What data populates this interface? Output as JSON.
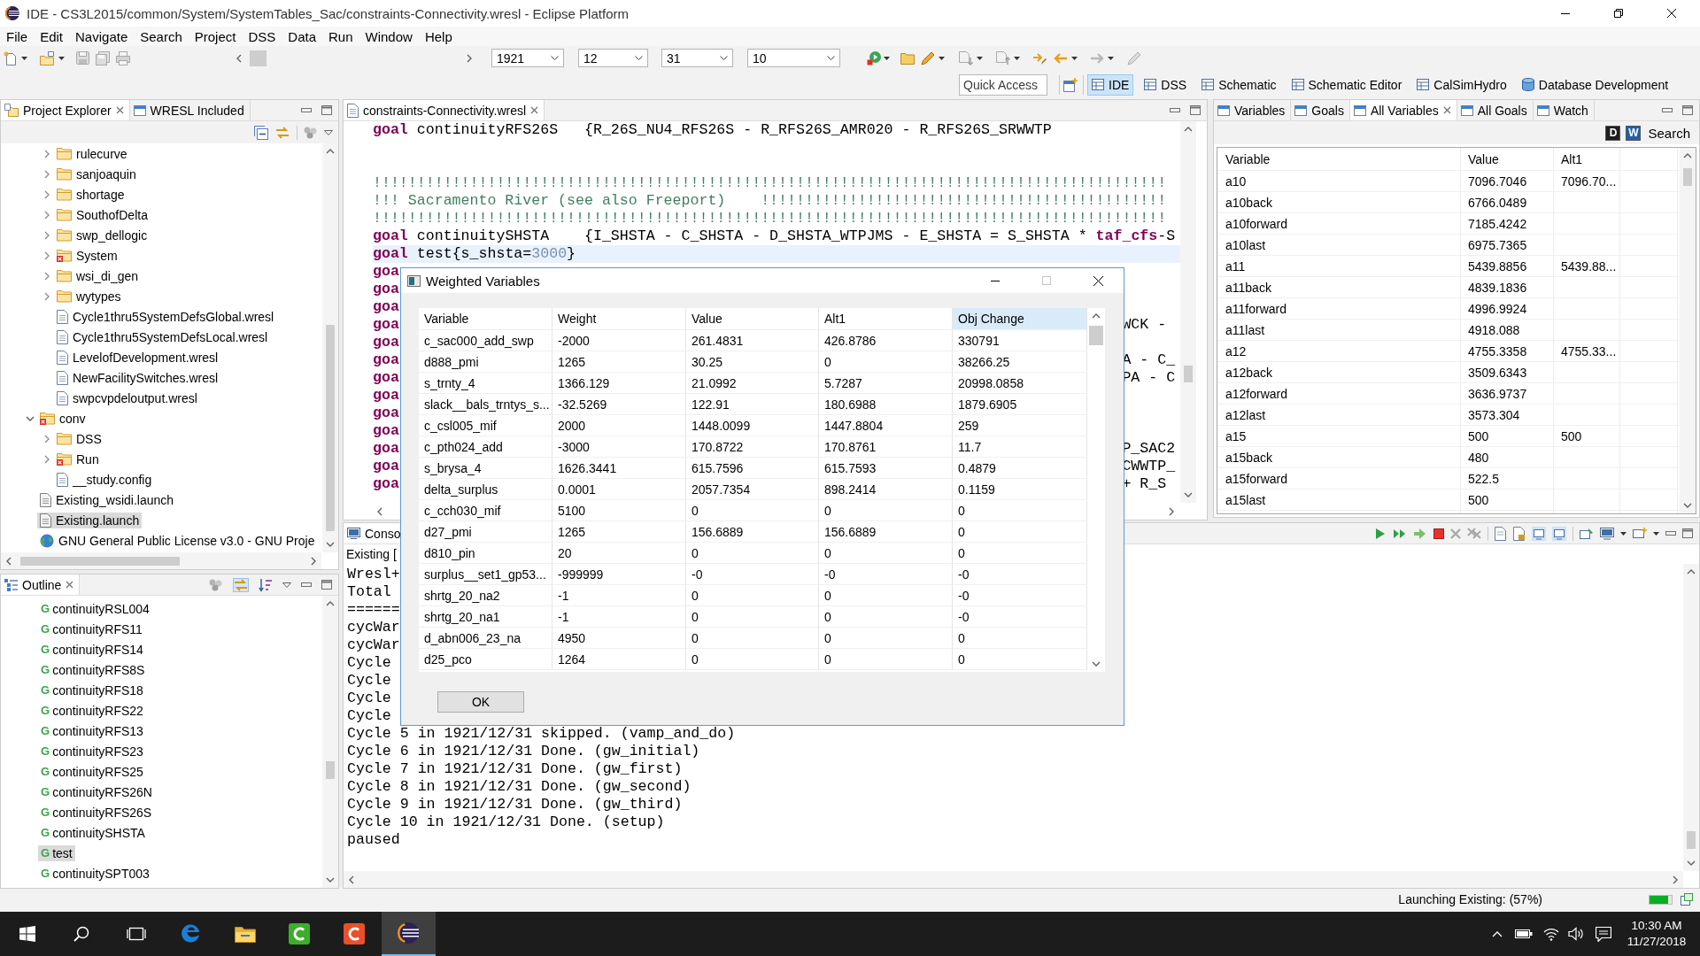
{
  "window": {
    "title": "IDE - CS3L2015/common/System/SystemTables_Sac/constraints-Connectivity.wresl - Eclipse Platform"
  },
  "menu": [
    "File",
    "Edit",
    "Navigate",
    "Search",
    "Project",
    "DSS",
    "Data",
    "Run",
    "Window",
    "Help"
  ],
  "toolbar": {
    "dropdowns": [
      {
        "value": "1921"
      },
      {
        "value": "12"
      },
      {
        "value": "31"
      },
      {
        "value": "10"
      }
    ],
    "quick_access": {
      "placeholder": "Quick Access"
    },
    "perspectives": [
      {
        "kind": "view",
        "label": "IDE",
        "selected": true
      },
      {
        "kind": "view",
        "label": "DSS",
        "selected": false
      },
      {
        "kind": "view",
        "label": "Schematic",
        "selected": false
      },
      {
        "kind": "view",
        "label": "Schematic Editor",
        "selected": false
      },
      {
        "kind": "view",
        "label": "CalSimHydro",
        "selected": false
      },
      {
        "kind": "database",
        "label": "Database Development",
        "selected": false
      }
    ]
  },
  "project_explorer": {
    "tabs": [
      {
        "label": "Project Explorer",
        "selected": true
      },
      {
        "label": "WRESL Included",
        "selected": false
      }
    ],
    "scrolled_children": [
      {
        "kind": "folder",
        "label": "rulecurve",
        "expanded": false,
        "error": false,
        "selected": false
      },
      {
        "kind": "folder",
        "label": "sanjoaquin",
        "expanded": false,
        "error": false,
        "selected": false
      },
      {
        "kind": "folder",
        "label": "shortage",
        "expanded": false,
        "error": false,
        "selected": false
      },
      {
        "kind": "folder",
        "label": "SouthofDelta",
        "expanded": false,
        "error": false,
        "selected": false
      },
      {
        "kind": "folder",
        "label": "swp_dellogic",
        "expanded": false,
        "error": false,
        "selected": false
      },
      {
        "kind": "folder",
        "label": "System",
        "expanded": false,
        "error": true,
        "selected": false
      },
      {
        "kind": "folder",
        "label": "wsi_di_gen",
        "expanded": false,
        "error": false,
        "selected": false
      },
      {
        "kind": "folder",
        "label": "wytypes",
        "expanded": false,
        "error": false,
        "selected": false
      },
      {
        "kind": "file",
        "label": "Cycle1thru5SystemDefsGlobal.wresl",
        "error": false,
        "selected": false
      },
      {
        "kind": "file",
        "label": "Cycle1thru5SystemDefsLocal.wresl",
        "error": false,
        "selected": false
      },
      {
        "kind": "file",
        "label": "LevelofDevelopment.wresl",
        "error": false,
        "selected": false
      },
      {
        "kind": "file",
        "label": "NewFacilitySwitches.wresl",
        "error": false,
        "selected": false
      },
      {
        "kind": "file",
        "label": "swpcvpdeloutput.wresl",
        "error": false,
        "selected": false
      }
    ],
    "items": [
      {
        "kind": "folder",
        "label": "conv",
        "expanded": true,
        "error": true,
        "selected": false,
        "children": [
          {
            "kind": "folder",
            "label": "DSS",
            "expanded": false,
            "error": false,
            "selected": false
          },
          {
            "kind": "folder",
            "label": "Run",
            "expanded": false,
            "error": true,
            "selected": false
          },
          {
            "kind": "file",
            "label": "__study.config",
            "error": false,
            "selected": false
          }
        ]
      },
      {
        "kind": "launch",
        "label": "Existing_wsidi.launch",
        "error": false,
        "selected": false
      },
      {
        "kind": "launch",
        "label": "Existing.launch",
        "error": false,
        "selected": true
      },
      {
        "kind": "web",
        "label": "GNU General Public License v3.0 - GNU Proje",
        "error": false,
        "selected": false
      }
    ]
  },
  "outline": {
    "title": "Outline",
    "items": [
      {
        "letter": "G",
        "label": "continuityRSL004",
        "selected": false
      },
      {
        "letter": "G",
        "label": "continuityRFS11",
        "selected": false
      },
      {
        "letter": "G",
        "label": "continuityRFS14",
        "selected": false
      },
      {
        "letter": "G",
        "label": "continuityRFS8S",
        "selected": false
      },
      {
        "letter": "G",
        "label": "continuityRFS18",
        "selected": false
      },
      {
        "letter": "G",
        "label": "continuityRFS22",
        "selected": false
      },
      {
        "letter": "G",
        "label": "continuityRFS13",
        "selected": false
      },
      {
        "letter": "G",
        "label": "continuityRFS23",
        "selected": false
      },
      {
        "letter": "G",
        "label": "continuityRFS25",
        "selected": false
      },
      {
        "letter": "G",
        "label": "continuityRFS26N",
        "selected": false
      },
      {
        "letter": "G",
        "label": "continuityRFS26S",
        "selected": false
      },
      {
        "letter": "G",
        "label": "continuitySHSTA",
        "selected": false
      },
      {
        "letter": "G",
        "label": "test",
        "selected": true
      },
      {
        "letter": "G",
        "label": "continuitySPT003",
        "selected": false
      }
    ]
  },
  "editor": {
    "tab": "constraints-Connectivity.wresl",
    "lines": [
      {
        "kind": "code",
        "current": false,
        "segments": [
          {
            "kind": "keyword",
            "text": "goal"
          },
          {
            "kind": "plain",
            "text": " continuityRFS26S   {R_26S_NU4_RFS26S - R_RFS26S_AMR020 - R_RFS26S_SRWWTP"
          }
        ]
      },
      {
        "kind": "blank"
      },
      {
        "kind": "blank"
      },
      {
        "kind": "code",
        "current": false,
        "segments": [
          {
            "kind": "comment",
            "text": "!!!!!!!!!!!!!!!!!!!!!!!!!!!!!!!!!!!!!!!!!!!!!!!!!!!!!!!!!!!!!!!!!!!!!!!!!!!!!!!!!!!!!!!!!!"
          }
        ]
      },
      {
        "kind": "code",
        "current": false,
        "segments": [
          {
            "kind": "comment",
            "text": "!!! Sacramento River (see also Freeport)    !!!!!!!!!!!!!!!!!!!!!!!!!!!!!!!!!!!!!!!!!!!!!!"
          }
        ]
      },
      {
        "kind": "code",
        "current": false,
        "segments": [
          {
            "kind": "comment",
            "text": "!!!!!!!!!!!!!!!!!!!!!!!!!!!!!!!!!!!!!!!!!!!!!!!!!!!!!!!!!!!!!!!!!!!!!!!!!!!!!!!!!!!!!!!!!!"
          }
        ]
      },
      {
        "kind": "code",
        "current": false,
        "segments": [
          {
            "kind": "keyword",
            "text": "goal"
          },
          {
            "kind": "plain",
            "text": " continuitySHSTA    {I_SHSTA - C_SHSTA - D_SHSTA_WTPJMS - E_SHSTA = S_SHSTA * "
          },
          {
            "kind": "keyword",
            "text": "taf_cfs"
          },
          {
            "kind": "plain",
            "text": "-S"
          }
        ]
      },
      {
        "kind": "code",
        "current": true,
        "segments": [
          {
            "kind": "keyword",
            "text": "goal"
          },
          {
            "kind": "plain",
            "text": " test{s_shsta="
          },
          {
            "kind": "number",
            "text": "3000"
          },
          {
            "kind": "plain",
            "text": "}"
          }
        ]
      },
      {
        "kind": "clipped",
        "left": [
          {
            "kind": "keyword",
            "text": "goa"
          }
        ]
      },
      {
        "kind": "clipped",
        "left": [
          {
            "kind": "keyword",
            "text": "goa"
          }
        ]
      },
      {
        "kind": "clipped",
        "left": [
          {
            "kind": "keyword",
            "text": "goa"
          }
        ]
      },
      {
        "kind": "clipped",
        "left": [
          {
            "kind": "keyword",
            "text": "goa"
          }
        ],
        "right": [
          {
            "kind": "plain",
            "text": "WCK -"
          }
        ]
      },
      {
        "kind": "clipped",
        "left": [
          {
            "kind": "keyword",
            "text": "goa"
          }
        ]
      },
      {
        "kind": "clipped",
        "left": [
          {
            "kind": "keyword",
            "text": "goa"
          }
        ],
        "right": [
          {
            "kind": "plain",
            "text": "A - C_"
          }
        ]
      },
      {
        "kind": "clipped",
        "left": [
          {
            "kind": "keyword",
            "text": "goa"
          }
        ],
        "right": [
          {
            "kind": "plain",
            "text": "PA - C"
          }
        ]
      },
      {
        "kind": "clipped",
        "left": [
          {
            "kind": "keyword",
            "text": "goa"
          }
        ]
      },
      {
        "kind": "clipped",
        "left": [
          {
            "kind": "keyword",
            "text": "goa"
          }
        ]
      },
      {
        "kind": "clipped",
        "left": [
          {
            "kind": "keyword",
            "text": "goa"
          }
        ]
      },
      {
        "kind": "clipped",
        "left": [
          {
            "kind": "keyword",
            "text": "goa"
          }
        ],
        "right": [
          {
            "kind": "plain",
            "text": "P_SAC2"
          }
        ]
      },
      {
        "kind": "clipped",
        "left": [
          {
            "kind": "keyword",
            "text": "goa"
          }
        ],
        "right": [
          {
            "kind": "plain",
            "text": "CWWTP_"
          }
        ]
      },
      {
        "kind": "clipped",
        "left": [
          {
            "kind": "keyword",
            "text": "goa"
          }
        ],
        "right": [
          {
            "kind": "plain",
            "text": "+ R_S"
          }
        ]
      }
    ]
  },
  "variables_panel": {
    "tabs": [
      {
        "label": "Variables",
        "selected": false
      },
      {
        "label": "Goals",
        "selected": false
      },
      {
        "label": "All Variables",
        "selected": true
      },
      {
        "label": "All Goals",
        "selected": false
      },
      {
        "label": "Watch",
        "selected": false
      }
    ],
    "tools": [
      {
        "letter": "D",
        "color": "#1e1e1e"
      },
      {
        "letter": "W",
        "color": "#1f5fae"
      }
    ],
    "search": "Search",
    "columns": [
      "Variable",
      "Value",
      "Alt1"
    ],
    "rows": [
      {
        "variable": "a10",
        "value": "7096.7046",
        "alt1": "7096.70..."
      },
      {
        "variable": "a10back",
        "value": "6766.0489"
      },
      {
        "variable": "a10forward",
        "value": "7185.4242"
      },
      {
        "variable": "a10last",
        "value": "6975.7365"
      },
      {
        "variable": "a11",
        "value": "5439.8856",
        "alt1": "5439.88..."
      },
      {
        "variable": "a11back",
        "value": "4839.1836"
      },
      {
        "variable": "a11forward",
        "value": "4996.9924"
      },
      {
        "variable": "a11last",
        "value": "4918.088"
      },
      {
        "variable": "a12",
        "value": "4755.3358",
        "alt1": "4755.33..."
      },
      {
        "variable": "a12back",
        "value": "3509.6343"
      },
      {
        "variable": "a12forward",
        "value": "3636.9737"
      },
      {
        "variable": "a12last",
        "value": "3573.304"
      },
      {
        "variable": "a15",
        "value": "500",
        "alt1": "500"
      },
      {
        "variable": "a15back",
        "value": "480"
      },
      {
        "variable": "a15forward",
        "value": "522.5"
      },
      {
        "variable": "a15last",
        "value": "500"
      }
    ]
  },
  "console": {
    "tab": "Conso",
    "title": "Existing [",
    "lines": [
      "Wresl+",
      "Total",
      "======",
      "cycWar",
      "cycWar",
      "Cycle",
      "Cycle",
      "Cycle",
      "Cycle",
      "Cycle 5 in 1921/12/31 skipped. (vamp_and_do)",
      "Cycle 6 in 1921/12/31 Done. (gw_initial)",
      "Cycle 7 in 1921/12/31 Done. (gw_first)",
      "Cycle 8 in 1921/12/31 Done. (gw_second)",
      "Cycle 9 in 1921/12/31 Done. (gw_third)",
      "Cycle 10 in 1921/12/31 Done. (setup)",
      "paused"
    ]
  },
  "status_bar": {
    "text": "Launching Existing: (57%)",
    "progress": {
      "level": 0.85
    }
  },
  "dialog": {
    "title": "Weighted Variables",
    "columns": [
      {
        "label": "Variable",
        "highlighted": false
      },
      {
        "label": "Weight",
        "highlighted": false
      },
      {
        "label": "Value",
        "highlighted": false
      },
      {
        "label": "Alt1",
        "highlighted": false
      },
      {
        "label": "Obj Change",
        "highlighted": true
      }
    ],
    "rows": [
      [
        "c_sac000_add_swp",
        "-2000",
        "261.4831",
        "426.8786",
        "330791"
      ],
      [
        "d888_pmi",
        "1265",
        "30.25",
        "0",
        "38266.25"
      ],
      [
        "s_trnty_4",
        "1366.129",
        "21.0992",
        "5.7287",
        "20998.0858"
      ],
      [
        "slack__bals_trntys_s...",
        "-32.5269",
        "122.91",
        "180.6988",
        "1879.6905"
      ],
      [
        "c_csl005_mif",
        "2000",
        "1448.0099",
        "1447.8804",
        "259"
      ],
      [
        "c_pth024_add",
        "-3000",
        "170.8722",
        "170.8761",
        "11.7"
      ],
      [
        "s_brysa_4",
        "1626.3441",
        "615.7596",
        "615.7593",
        "0.4879"
      ],
      [
        "delta_surplus",
        "0.0001",
        "2057.7354",
        "898.2414",
        "0.1159"
      ],
      [
        "c_cch030_mif",
        "5100",
        "0",
        "0",
        "0"
      ],
      [
        "d27_pmi",
        "1265",
        "156.6889",
        "156.6889",
        "0"
      ],
      [
        "d810_pin",
        "20",
        "0",
        "0",
        "0"
      ],
      [
        "surplus__set1_gp53...",
        "-999999",
        "-0",
        "-0",
        "-0"
      ],
      [
        "shrtg_20_na2",
        "-1",
        "0",
        "0",
        "-0"
      ],
      [
        "shrtg_20_na1",
        "-1",
        "0",
        "0",
        "-0"
      ],
      [
        "d_abn006_23_na",
        "4950",
        "0",
        "0",
        "0"
      ],
      [
        "d25_pco",
        "1264",
        "0",
        "0",
        "0"
      ]
    ],
    "button": "OK"
  },
  "taskbar": {
    "apps": [
      {
        "kind": "browser",
        "active": false
      },
      {
        "kind": "folder",
        "active": false
      },
      {
        "kind": "greentile",
        "active": false
      },
      {
        "kind": "redtile",
        "active": false
      },
      {
        "kind": "eclipse",
        "active": true
      }
    ],
    "time": "10:30 AM",
    "date": "11/27/2018"
  }
}
